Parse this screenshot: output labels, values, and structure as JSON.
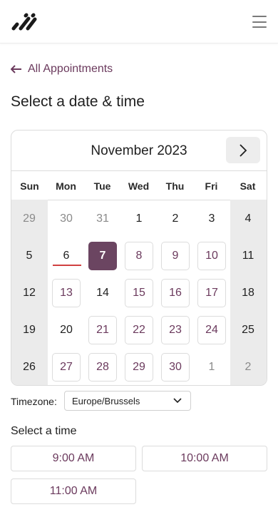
{
  "header": {
    "logo_icon": "brand-logo-icon",
    "menu_icon": "hamburger-menu-icon"
  },
  "back_link": {
    "label": "All Appointments",
    "icon": "arrow-left-icon"
  },
  "page_title": "Select a date & time",
  "calendar": {
    "month_label": "November 2023",
    "next_icon": "chevron-right-icon",
    "weekdays": [
      "Sun",
      "Mon",
      "Tue",
      "Wed",
      "Thu",
      "Fri",
      "Sat"
    ],
    "weeks": [
      [
        "29",
        "30",
        "31",
        "1",
        "2",
        "3",
        "4"
      ],
      [
        "5",
        "6",
        "7",
        "8",
        "9",
        "10",
        "11"
      ],
      [
        "12",
        "13",
        "14",
        "15",
        "16",
        "17",
        "18"
      ],
      [
        "19",
        "20",
        "21",
        "22",
        "23",
        "24",
        "25"
      ],
      [
        "26",
        "27",
        "28",
        "29",
        "30",
        "1",
        "2"
      ]
    ],
    "selected_date": "7",
    "today": "6"
  },
  "timezone": {
    "label": "Timezone:",
    "value": "Europe/Brussels"
  },
  "time_section": {
    "label": "Select a time",
    "slots": [
      "9:00 AM",
      "10:00 AM",
      "11:00 AM"
    ]
  },
  "colors": {
    "accent": "#6b3a5d",
    "selected_bg": "#6b4561",
    "today_marker": "#d04040",
    "weekend_bg": "#ebebeb"
  }
}
